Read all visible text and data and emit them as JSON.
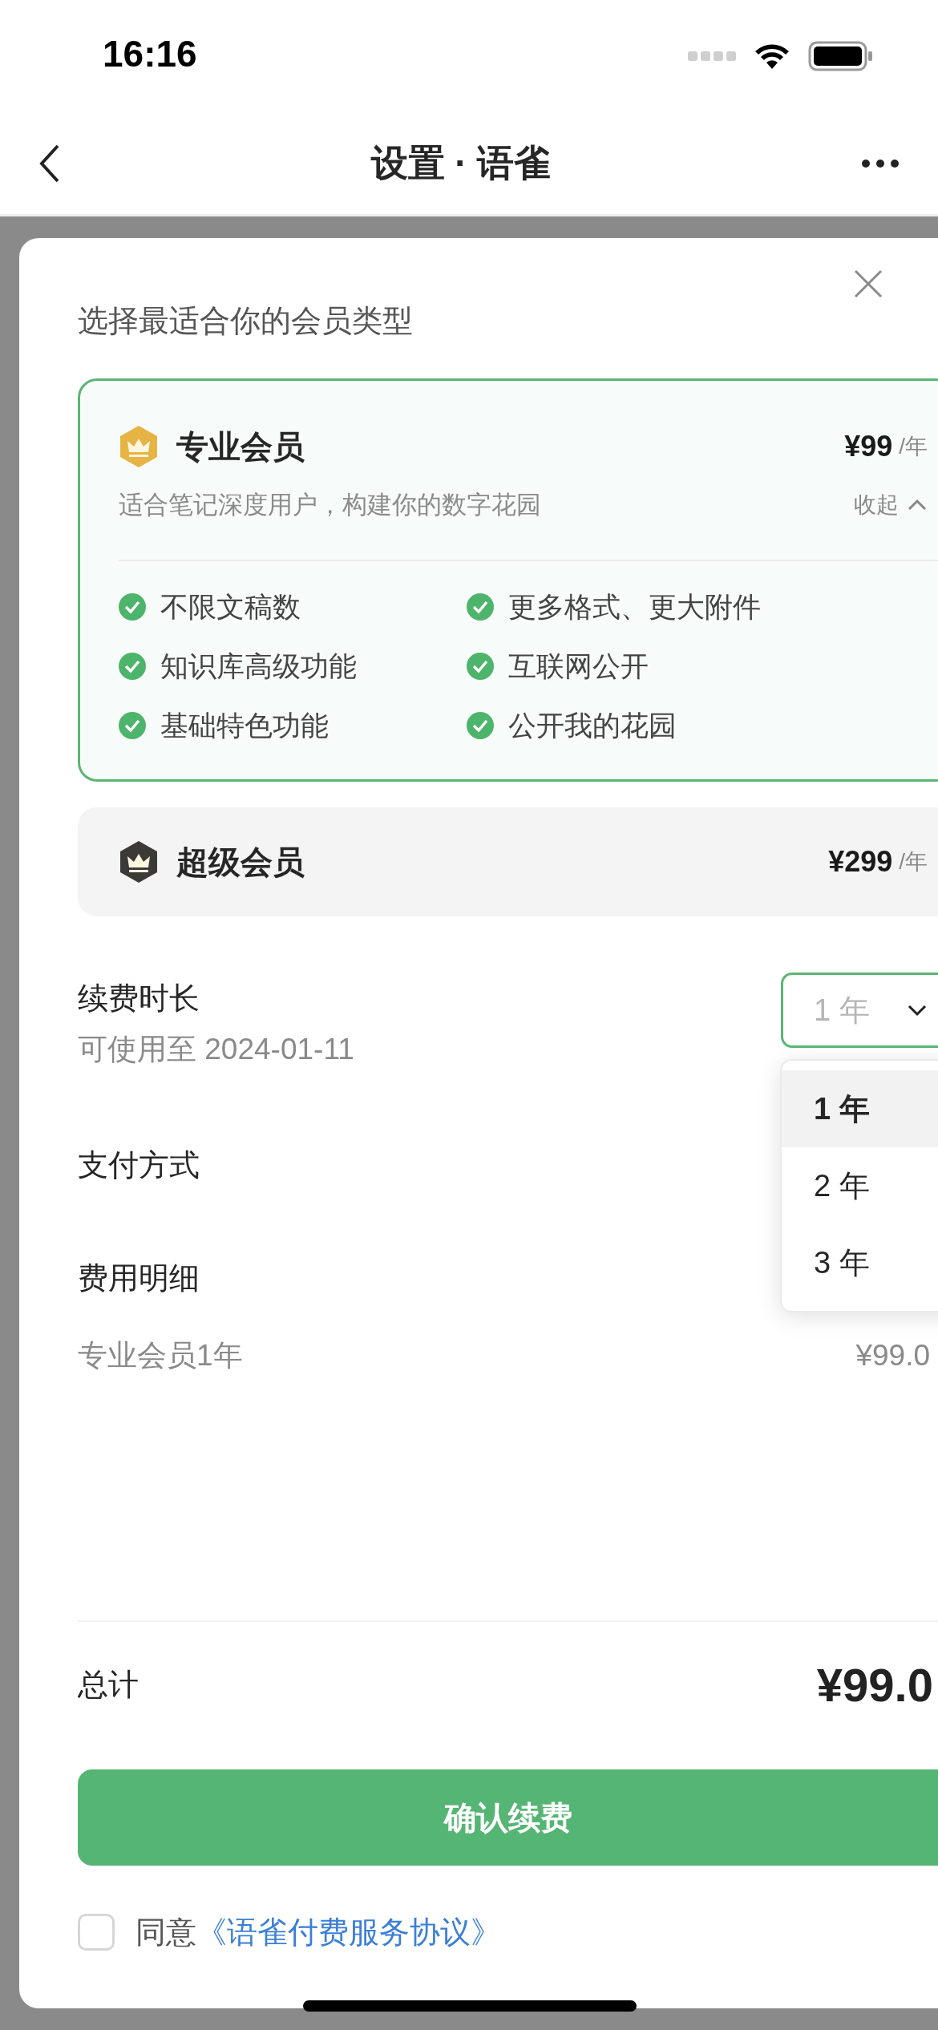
{
  "status_bar": {
    "time": "16:16"
  },
  "nav": {
    "title": "设置 · 语雀"
  },
  "modal": {
    "heading": "选择最适合你的会员类型",
    "plans": [
      {
        "name": "专业会员",
        "price": "¥99",
        "unit": "/年",
        "color": "#e6b445",
        "selected": true,
        "expanded": true,
        "description": "适合笔记深度用户，构建你的数字花园",
        "collapse_label": "收起",
        "features": [
          "不限文稿数",
          "更多格式、更大附件",
          "知识库高级功能",
          "互联网公开",
          "基础特色功能",
          "公开我的花园"
        ]
      },
      {
        "name": "超级会员",
        "price": "¥299",
        "unit": "/年",
        "color": "#3b3a36",
        "selected": false,
        "expanded": false
      }
    ],
    "duration": {
      "label": "续费时长",
      "note": "可使用至 2024-01-11",
      "value": "1 年",
      "options": [
        {
          "label": "1 年",
          "selected": true
        },
        {
          "label": "2 年",
          "selected": false
        },
        {
          "label": "3 年",
          "selected": false
        }
      ]
    },
    "payment": {
      "label": "支付方式"
    },
    "details": {
      "label": "费用明细",
      "items": [
        {
          "name": "专业会员1年",
          "amount": "¥99.0"
        }
      ]
    },
    "total": {
      "label": "总计",
      "amount": "¥99.0"
    },
    "confirm_button": "确认续费",
    "agreement": {
      "checked": false,
      "prefix": "同意",
      "link": "《语雀付费服务协议》"
    }
  }
}
